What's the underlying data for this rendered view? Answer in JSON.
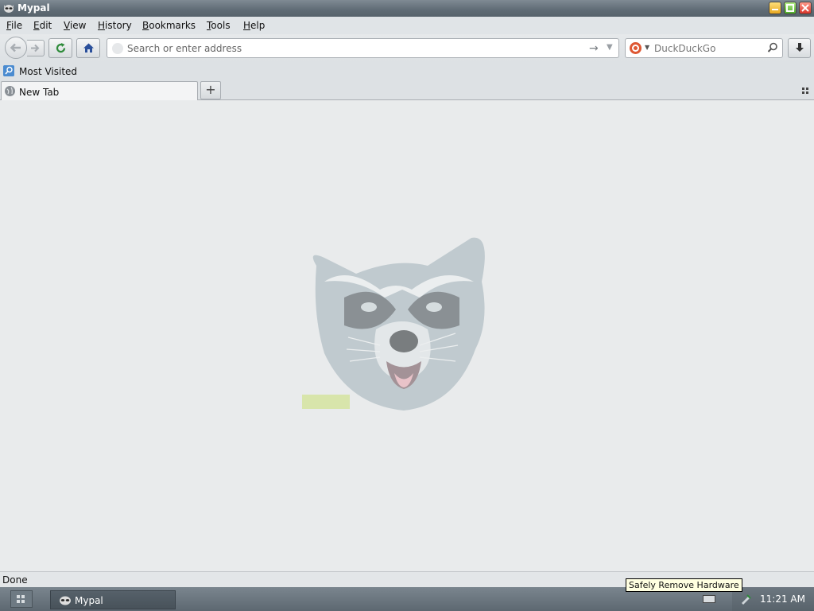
{
  "window": {
    "title": "Mypal"
  },
  "menu": {
    "items": [
      {
        "label": "File",
        "accel": "F",
        "rest": "ile"
      },
      {
        "label": "Edit",
        "accel": "E",
        "rest": "dit"
      },
      {
        "label": "View",
        "accel": "V",
        "rest": "iew"
      },
      {
        "label": "History",
        "accel": "H",
        "rest": "istory"
      },
      {
        "label": "Bookmarks",
        "accel": "B",
        "rest": "ookmarks"
      },
      {
        "label": "Tools",
        "accel": "T",
        "rest": "ools"
      },
      {
        "label": "Help",
        "accel": "H",
        "rest": "elp"
      }
    ]
  },
  "navbar": {
    "url_placeholder": "Search or enter address",
    "url_value": "",
    "search_engine": "DuckDuckGo",
    "search_placeholder": "DuckDuckGo"
  },
  "bookmarks": {
    "items": [
      {
        "label": "Most Visited"
      }
    ]
  },
  "tabs": {
    "items": [
      {
        "label": "New Tab",
        "selected": true
      }
    ]
  },
  "status": {
    "text": "Done"
  },
  "taskbar": {
    "task_label": "Mypal",
    "clock": "11:21 AM",
    "tooltip": "Safely Remove Hardware"
  },
  "colors": {
    "titlebar": "#5f6b75",
    "content_bg": "#e9ebec",
    "reload": "#2e8b3a",
    "home": "#2a4f9a"
  }
}
